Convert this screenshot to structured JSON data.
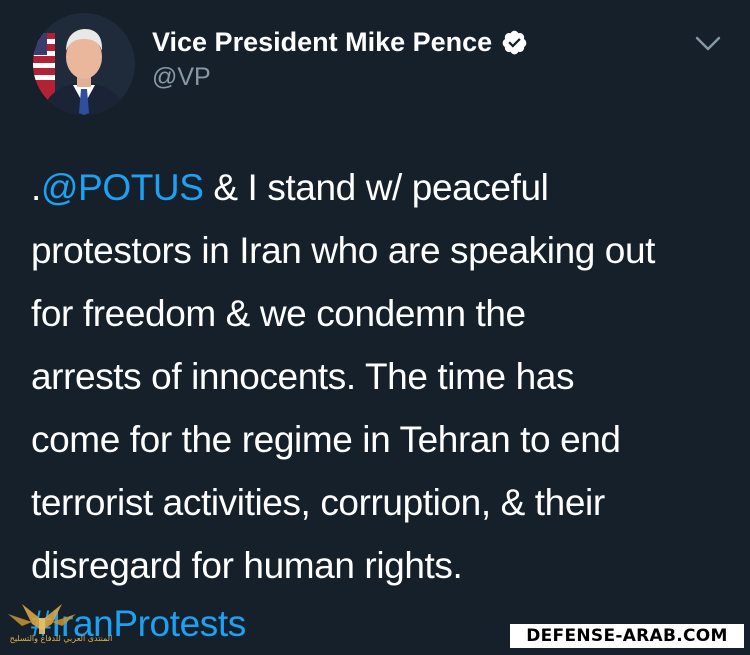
{
  "author": {
    "display_name": "Vice President Mike Pence",
    "handle": "@VP",
    "verified": true,
    "verified_icon": "verified-badge-icon",
    "avatar_icon": "profile-photo"
  },
  "menu": {
    "caret_icon": "chevron-down-icon"
  },
  "tweet": {
    "lines": [
      {
        "prefix": ".",
        "mention": "@POTUS",
        "rest": " & I stand w/ peaceful"
      },
      {
        "text": "protestors in Iran who are speaking out"
      },
      {
        "text": "for freedom & we condemn the"
      },
      {
        "text": "arrests of innocents. The time has"
      },
      {
        "text": "come for the regime in Tehran to end"
      },
      {
        "text": "terrorist activities, corruption, & their"
      },
      {
        "text": "disregard for human rights."
      }
    ],
    "hashtag": "#IranProtests"
  },
  "watermark": {
    "text": "DEFENSE-ARAB.COM",
    "logo_caption": "المنتدى العربي للدفاع والتسليح"
  },
  "colors": {
    "background": "#15202b",
    "text": "#ffffff",
    "secondary": "#8899a6",
    "link": "#1da1f2"
  }
}
